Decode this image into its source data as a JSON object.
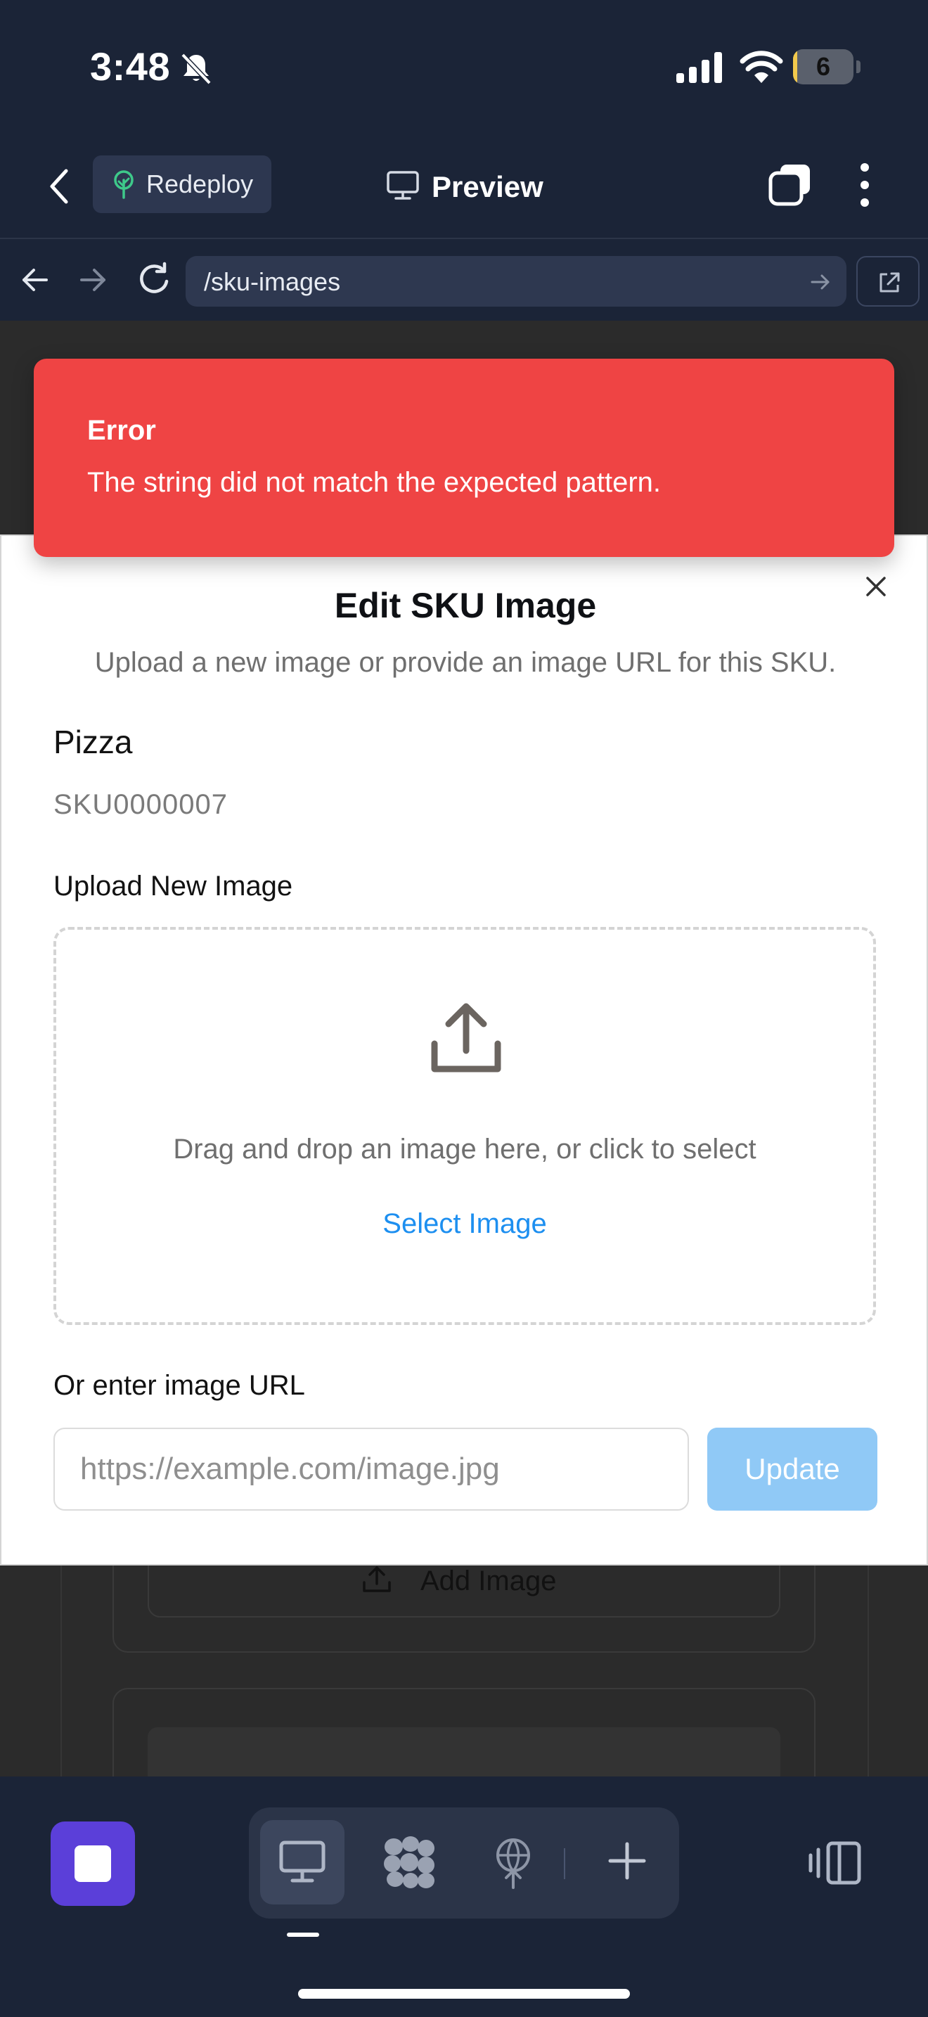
{
  "status_bar": {
    "time": "3:48",
    "battery_level": "6",
    "battery_fraction": 0.06
  },
  "top_bar": {
    "redeploy_label": "Redeploy",
    "preview_label": "Preview"
  },
  "browser": {
    "url": "/sku-images"
  },
  "background_page": {
    "add_image_label": "Add Image"
  },
  "toast": {
    "title": "Error",
    "message": "The string did not match the expected pattern.",
    "color": "#ef4444"
  },
  "modal": {
    "title": "Edit SKU Image",
    "subtitle": "Upload a new image or provide an image URL for this SKU.",
    "product_name": "Pizza",
    "product_sku": "SKU0000007",
    "upload_label": "Upload New Image",
    "dropzone_text": "Drag and drop an image here, or click to select",
    "select_image_label": "Select Image",
    "url_label": "Or enter image URL",
    "url_value": "",
    "url_placeholder": "https://example.com/image.jpg",
    "update_label": "Update"
  },
  "colors": {
    "app_background": "#1b2437",
    "accent": "#1d8ff0",
    "stop_button": "#5b3fd9"
  },
  "icons": {
    "back": "chevron-left-icon",
    "redeploy": "tree-icon",
    "preview": "monitor-icon",
    "tabs": "tabs-icon",
    "more": "more-vertical-icon",
    "close": "close-icon",
    "upload": "upload-icon"
  }
}
